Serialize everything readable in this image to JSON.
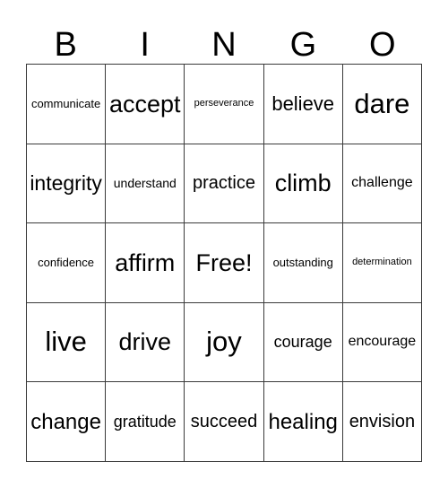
{
  "card": {
    "title": "BINGO",
    "free_space_label": "Free!"
  },
  "header": {
    "letters": [
      "B",
      "I",
      "N",
      "G",
      "O"
    ]
  },
  "grid": {
    "columns": 5,
    "rows": 5,
    "border_color": "#3a3a3a",
    "background_color": "#ffffff",
    "text_color": "#000000",
    "cells": [
      {
        "text": "communicate",
        "size": "fs-s"
      },
      {
        "text": "accept",
        "size": "fs-3xl"
      },
      {
        "text": "perseverance",
        "size": "fs-xxs"
      },
      {
        "text": "believe",
        "size": "fs-xl"
      },
      {
        "text": "dare",
        "size": "fs-4xl"
      },
      {
        "text": "integrity",
        "size": "fs-xxl"
      },
      {
        "text": "understand",
        "size": "fs-sm"
      },
      {
        "text": "practice",
        "size": "fs-l"
      },
      {
        "text": "climb",
        "size": "fs-3xl"
      },
      {
        "text": "challenge",
        "size": "fs-m"
      },
      {
        "text": "confidence",
        "size": "fs-s"
      },
      {
        "text": "affirm",
        "size": "fs-3xl"
      },
      {
        "text": "Free!",
        "size": "fs-3xl"
      },
      {
        "text": "outstanding",
        "size": "fs-s"
      },
      {
        "text": "determination",
        "size": "fs-xxs"
      },
      {
        "text": "live",
        "size": "fs-4xl"
      },
      {
        "text": "drive",
        "size": "fs-3xl"
      },
      {
        "text": "joy",
        "size": "fs-4xl"
      },
      {
        "text": "courage",
        "size": "fs-ml"
      },
      {
        "text": "encourage",
        "size": "fs-m"
      },
      {
        "text": "change",
        "size": "fs-xxl"
      },
      {
        "text": "gratitude",
        "size": "fs-ml"
      },
      {
        "text": "succeed",
        "size": "fs-l"
      },
      {
        "text": "healing",
        "size": "fs-xxl"
      },
      {
        "text": "envision",
        "size": "fs-l"
      }
    ]
  }
}
